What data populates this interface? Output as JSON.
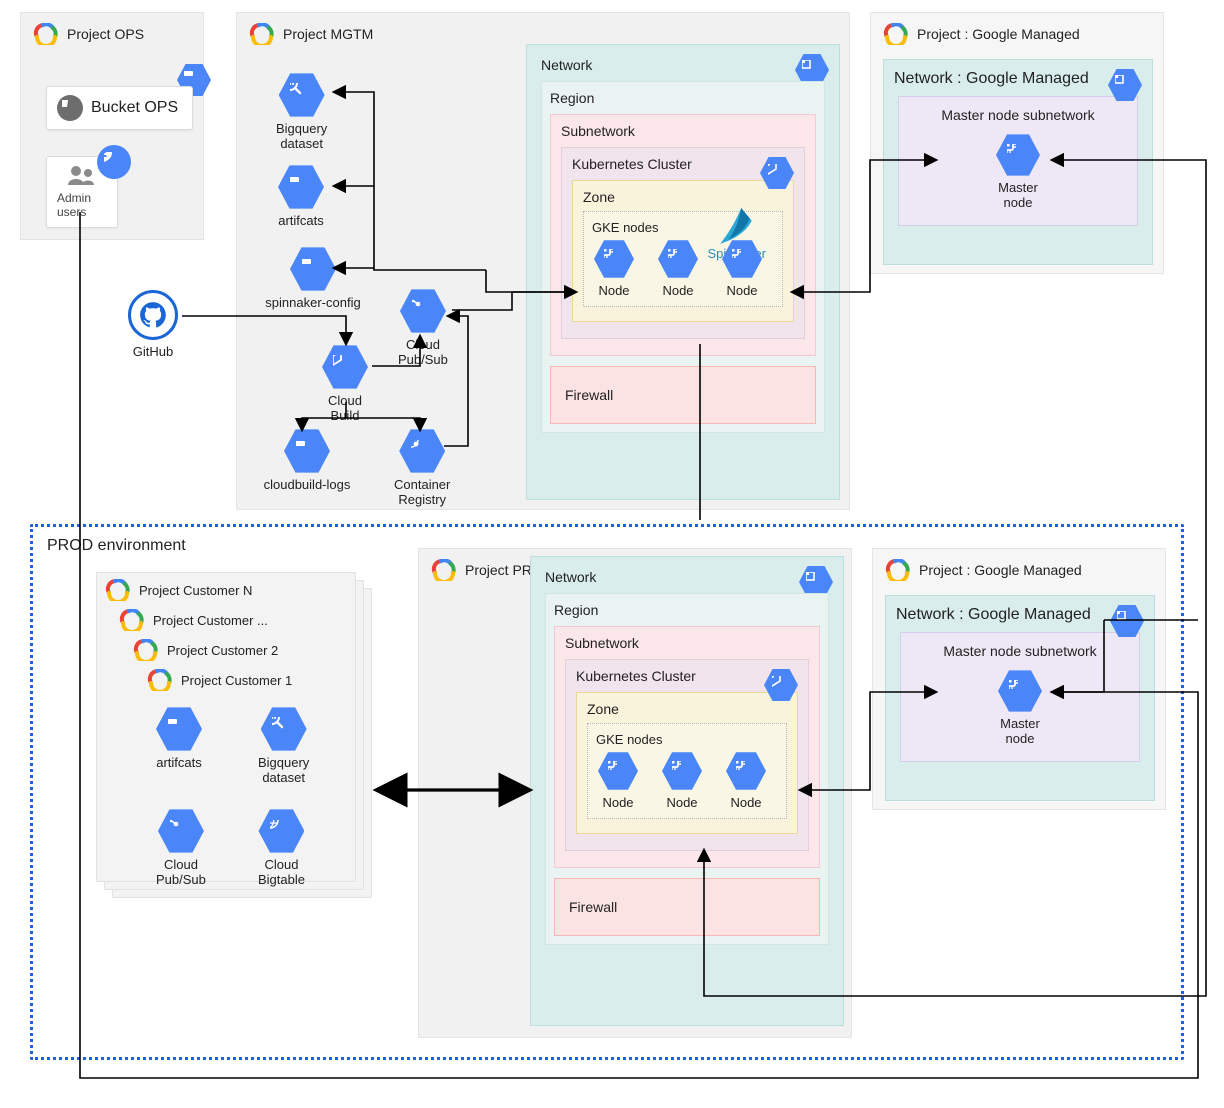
{
  "ops": {
    "title": "Project OPS",
    "bucket": "Bucket OPS",
    "admin": "Admin users"
  },
  "github": "GitHub",
  "mgtm": {
    "title": "Project MGTM",
    "bigquery": "Bigquery\ndataset",
    "artifacts": "artifcats",
    "spinnaker_cfg": "spinnaker-config",
    "cloudbuild": "Cloud\nBuild",
    "pubsub": "Cloud\nPub/Sub",
    "cb_logs": "cloudbuild-logs",
    "registry": "Container\nRegistry",
    "net": {
      "network": "Network",
      "region": "Region",
      "subnet": "Subnetwork",
      "k8s": "Kubernetes Cluster",
      "zone": "Zone",
      "gke": "GKE nodes",
      "node": "Node",
      "fw": "Firewall",
      "spinnaker": "Spinnaker"
    }
  },
  "gm_top": {
    "title": "Project : Google Managed",
    "network": "Network : Google Managed",
    "masterSub": "Master node subnetwork",
    "master": "Master\nnode"
  },
  "prod_env": {
    "title": "PROD environment",
    "customers": [
      "Project Customer N",
      "Project Customer ...",
      "Project Customer 2",
      "Project Customer 1"
    ],
    "artifacts": "artifcats",
    "bigquery": "Bigquery\ndataset",
    "pubsub": "Cloud\nPub/Sub",
    "bigtable": "Cloud\nBigtable",
    "prod": {
      "title": "Project PROD",
      "net": {
        "network": "Network",
        "region": "Region",
        "subnet": "Subnetwork",
        "k8s": "Kubernetes Cluster",
        "zone": "Zone",
        "gke": "GKE nodes",
        "node": "Node",
        "fw": "Firewall"
      }
    },
    "gm": {
      "title": "Project : Google Managed",
      "network": "Network : Google Managed",
      "masterSub": "Master node subnetwork",
      "master": "Master\nnode"
    }
  }
}
